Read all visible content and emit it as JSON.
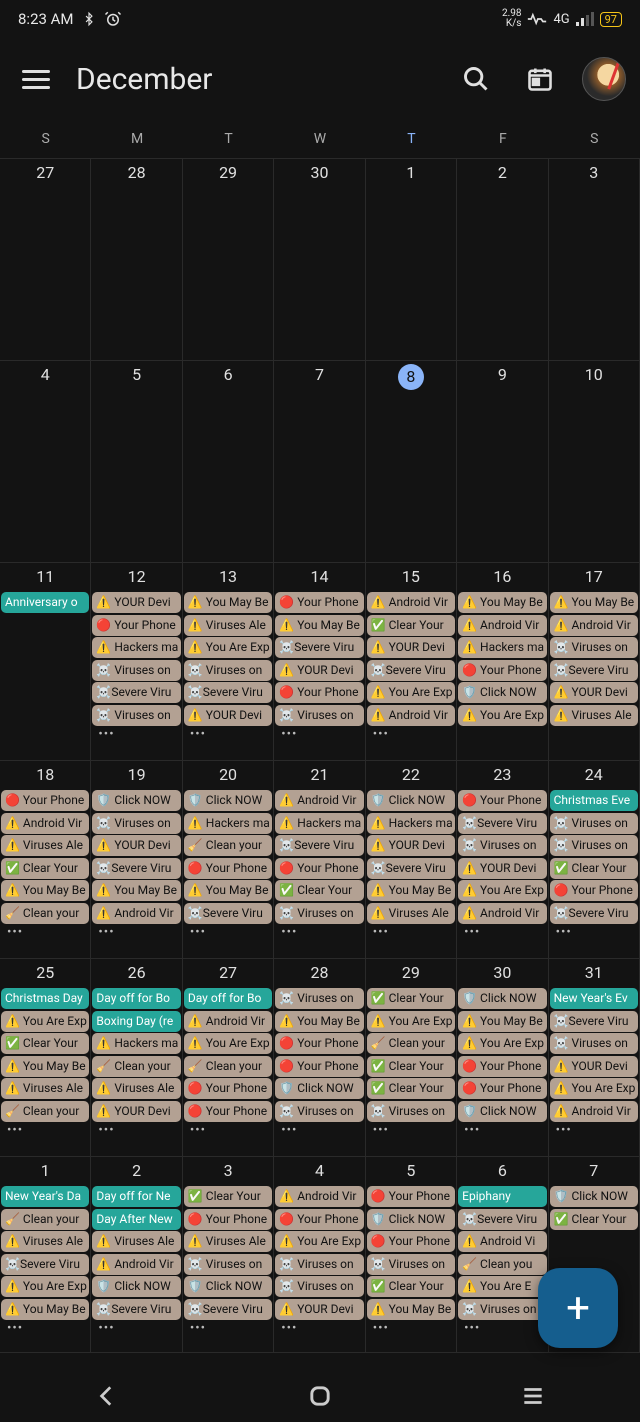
{
  "status": {
    "time": "8:23 AM",
    "net_speed": "2.98",
    "net_unit": "K/s",
    "net_type": "4G",
    "battery": "97"
  },
  "header": {
    "title": "December"
  },
  "weekdays": [
    "S",
    "M",
    "T",
    "W",
    "T",
    "F",
    "S"
  ],
  "today_col_index": 4,
  "rows": [
    [
      {
        "n": "27",
        "t": false,
        "e": []
      },
      {
        "n": "28",
        "t": false,
        "e": []
      },
      {
        "n": "29",
        "t": false,
        "e": []
      },
      {
        "n": "30",
        "t": false,
        "e": []
      },
      {
        "n": "1",
        "t": false,
        "e": []
      },
      {
        "n": "2",
        "t": false,
        "e": []
      },
      {
        "n": "3",
        "t": false,
        "e": []
      }
    ],
    [
      {
        "n": "4",
        "t": false,
        "e": []
      },
      {
        "n": "5",
        "t": false,
        "e": []
      },
      {
        "n": "6",
        "t": false,
        "e": []
      },
      {
        "n": "7",
        "t": false,
        "e": []
      },
      {
        "n": "8",
        "t": true,
        "e": []
      },
      {
        "n": "9",
        "t": false,
        "e": []
      },
      {
        "n": "10",
        "t": false,
        "e": []
      }
    ],
    [
      {
        "n": "11",
        "t": false,
        "more": false,
        "e": [
          {
            "c": "teal",
            "x": "Anniversary o"
          }
        ]
      },
      {
        "n": "12",
        "t": false,
        "more": true,
        "e": [
          {
            "c": "default",
            "x": "⚠️ YOUR Devi"
          },
          {
            "c": "default",
            "x": "🔴 Your Phone"
          },
          {
            "c": "default",
            "x": "⚠️ Hackers ma"
          },
          {
            "c": "default",
            "x": "☠️ Viruses on"
          },
          {
            "c": "default",
            "x": "☠️Severe Viru"
          },
          {
            "c": "default",
            "x": "☠️ Viruses on"
          }
        ]
      },
      {
        "n": "13",
        "t": false,
        "more": true,
        "e": [
          {
            "c": "default",
            "x": "⚠️ You May Be"
          },
          {
            "c": "default",
            "x": "⚠️ Viruses Ale"
          },
          {
            "c": "default",
            "x": "⚠️ You Are Exp"
          },
          {
            "c": "default",
            "x": "☠️ Viruses on"
          },
          {
            "c": "default",
            "x": "☠️Severe Viru"
          },
          {
            "c": "default",
            "x": "⚠️ YOUR Devi"
          }
        ]
      },
      {
        "n": "14",
        "t": false,
        "more": true,
        "e": [
          {
            "c": "default",
            "x": "🔴 Your Phone"
          },
          {
            "c": "default",
            "x": "⚠️ You May Be"
          },
          {
            "c": "default",
            "x": "☠️Severe Viru"
          },
          {
            "c": "default",
            "x": "⚠️ YOUR Devi"
          },
          {
            "c": "default",
            "x": "🔴 Your Phone"
          },
          {
            "c": "default",
            "x": "☠️ Viruses on"
          }
        ]
      },
      {
        "n": "15",
        "t": false,
        "more": true,
        "e": [
          {
            "c": "default",
            "x": "⚠️ Android Vir"
          },
          {
            "c": "default",
            "x": "✅ Clear Your"
          },
          {
            "c": "default",
            "x": "⚠️ YOUR Devi"
          },
          {
            "c": "default",
            "x": "☠️Severe Viru"
          },
          {
            "c": "default",
            "x": "⚠️ You Are Exp"
          },
          {
            "c": "default",
            "x": "⚠️ Android Vir"
          }
        ]
      },
      {
        "n": "16",
        "t": false,
        "more": false,
        "e": [
          {
            "c": "default",
            "x": "⚠️ You May Be"
          },
          {
            "c": "default",
            "x": "⚠️ Android Vir"
          },
          {
            "c": "default",
            "x": "⚠️ Hackers ma"
          },
          {
            "c": "default",
            "x": "🔴 Your Phone"
          },
          {
            "c": "default",
            "x": "🛡️ Click NOW"
          },
          {
            "c": "default",
            "x": "⚠️ You Are Exp"
          }
        ]
      },
      {
        "n": "17",
        "t": false,
        "more": false,
        "e": [
          {
            "c": "default",
            "x": "⚠️ You May Be"
          },
          {
            "c": "default",
            "x": "⚠️ Android Vir"
          },
          {
            "c": "default",
            "x": "☠️ Viruses on"
          },
          {
            "c": "default",
            "x": "☠️Severe Viru"
          },
          {
            "c": "default",
            "x": "⚠️ YOUR Devi"
          },
          {
            "c": "default",
            "x": "⚠️ Viruses Ale"
          }
        ]
      }
    ],
    [
      {
        "n": "18",
        "t": false,
        "more": true,
        "e": [
          {
            "c": "default",
            "x": "🔴 Your Phone"
          },
          {
            "c": "default",
            "x": "⚠️ Android Vir"
          },
          {
            "c": "default",
            "x": "⚠️ Viruses Ale"
          },
          {
            "c": "default",
            "x": "✅ Clear Your"
          },
          {
            "c": "default",
            "x": "⚠️ You May Be"
          },
          {
            "c": "default",
            "x": "🧹 Clean your"
          }
        ]
      },
      {
        "n": "19",
        "t": false,
        "more": true,
        "e": [
          {
            "c": "default",
            "x": "🛡️ Click NOW"
          },
          {
            "c": "default",
            "x": "☠️ Viruses on"
          },
          {
            "c": "default",
            "x": "⚠️ YOUR Devi"
          },
          {
            "c": "default",
            "x": "☠️Severe Viru"
          },
          {
            "c": "default",
            "x": "⚠️ You May Be"
          },
          {
            "c": "default",
            "x": "⚠️ Android Vir"
          }
        ]
      },
      {
        "n": "20",
        "t": false,
        "more": true,
        "e": [
          {
            "c": "default",
            "x": "🛡️ Click NOW"
          },
          {
            "c": "default",
            "x": "⚠️ Hackers ma"
          },
          {
            "c": "default",
            "x": "🧹 Clean your"
          },
          {
            "c": "default",
            "x": "🔴 Your Phone"
          },
          {
            "c": "default",
            "x": "⚠️ You May Be"
          },
          {
            "c": "default",
            "x": "☠️Severe Viru"
          }
        ]
      },
      {
        "n": "21",
        "t": false,
        "more": true,
        "e": [
          {
            "c": "default",
            "x": "⚠️ Android Vir"
          },
          {
            "c": "default",
            "x": "⚠️ Hackers ma"
          },
          {
            "c": "default",
            "x": "☠️Severe Viru"
          },
          {
            "c": "default",
            "x": "🔴 Your Phone"
          },
          {
            "c": "default",
            "x": "✅ Clear Your"
          },
          {
            "c": "default",
            "x": "☠️ Viruses on"
          }
        ]
      },
      {
        "n": "22",
        "t": false,
        "more": true,
        "e": [
          {
            "c": "default",
            "x": "🛡️ Click NOW"
          },
          {
            "c": "default",
            "x": "⚠️ Hackers ma"
          },
          {
            "c": "default",
            "x": "⚠️ YOUR Devi"
          },
          {
            "c": "default",
            "x": "☠️Severe Viru"
          },
          {
            "c": "default",
            "x": "⚠️ You May Be"
          },
          {
            "c": "default",
            "x": "⚠️ Viruses Ale"
          }
        ]
      },
      {
        "n": "23",
        "t": false,
        "more": true,
        "e": [
          {
            "c": "default",
            "x": "🔴 Your Phone"
          },
          {
            "c": "default",
            "x": "☠️Severe Viru"
          },
          {
            "c": "default",
            "x": "☠️ Viruses on"
          },
          {
            "c": "default",
            "x": "⚠️ YOUR Devi"
          },
          {
            "c": "default",
            "x": "⚠️ You Are Exp"
          },
          {
            "c": "default",
            "x": "⚠️ Android Vir"
          }
        ]
      },
      {
        "n": "24",
        "t": false,
        "more": true,
        "e": [
          {
            "c": "teal",
            "x": "Christmas Eve"
          },
          {
            "c": "default",
            "x": "☠️ Viruses on"
          },
          {
            "c": "default",
            "x": "☠️ Viruses on"
          },
          {
            "c": "default",
            "x": "✅ Clear Your"
          },
          {
            "c": "default",
            "x": "🔴 Your Phone"
          },
          {
            "c": "default",
            "x": "☠️Severe Viru"
          }
        ]
      }
    ],
    [
      {
        "n": "25",
        "t": false,
        "more": true,
        "e": [
          {
            "c": "teal",
            "x": "Christmas Day"
          },
          {
            "c": "default",
            "x": "⚠️ You Are Exp"
          },
          {
            "c": "default",
            "x": "✅ Clear Your"
          },
          {
            "c": "default",
            "x": "⚠️ You May Be"
          },
          {
            "c": "default",
            "x": "⚠️ Viruses Ale"
          },
          {
            "c": "default",
            "x": "🧹 Clean your"
          }
        ]
      },
      {
        "n": "26",
        "t": false,
        "more": true,
        "e": [
          {
            "c": "teal",
            "x": "Day off for Bo"
          },
          {
            "c": "teal",
            "x": "Boxing Day (re"
          },
          {
            "c": "default",
            "x": "⚠️ Hackers ma"
          },
          {
            "c": "default",
            "x": "🧹 Clean your"
          },
          {
            "c": "default",
            "x": "⚠️ Viruses Ale"
          },
          {
            "c": "default",
            "x": "⚠️ YOUR Devi"
          }
        ]
      },
      {
        "n": "27",
        "t": false,
        "more": true,
        "e": [
          {
            "c": "teal",
            "x": "Day off for Bo"
          },
          {
            "c": "default",
            "x": "⚠️ Android Vir"
          },
          {
            "c": "default",
            "x": "⚠️ You Are Exp"
          },
          {
            "c": "default",
            "x": "🧹 Clean your"
          },
          {
            "c": "default",
            "x": "🔴 Your Phone"
          },
          {
            "c": "default",
            "x": "🔴 Your Phone"
          }
        ]
      },
      {
        "n": "28",
        "t": false,
        "more": true,
        "e": [
          {
            "c": "default",
            "x": "☠️ Viruses on"
          },
          {
            "c": "default",
            "x": "⚠️ You May Be"
          },
          {
            "c": "default",
            "x": "🔴 Your Phone"
          },
          {
            "c": "default",
            "x": "🔴 Your Phone"
          },
          {
            "c": "default",
            "x": "🛡️ Click NOW"
          },
          {
            "c": "default",
            "x": "☠️ Viruses on"
          }
        ]
      },
      {
        "n": "29",
        "t": false,
        "more": true,
        "e": [
          {
            "c": "default",
            "x": "✅ Clear Your"
          },
          {
            "c": "default",
            "x": "⚠️ You Are Exp"
          },
          {
            "c": "default",
            "x": "🧹 Clean your"
          },
          {
            "c": "default",
            "x": "✅ Clear Your"
          },
          {
            "c": "default",
            "x": "✅ Clear Your"
          },
          {
            "c": "default",
            "x": "☠️ Viruses on"
          }
        ]
      },
      {
        "n": "30",
        "t": false,
        "more": true,
        "e": [
          {
            "c": "default",
            "x": "🛡️ Click NOW"
          },
          {
            "c": "default",
            "x": "⚠️ You May Be"
          },
          {
            "c": "default",
            "x": "⚠️ You Are Exp"
          },
          {
            "c": "default",
            "x": "🔴 Your Phone"
          },
          {
            "c": "default",
            "x": "🔴 Your Phone"
          },
          {
            "c": "default",
            "x": "🛡️ Click NOW"
          }
        ]
      },
      {
        "n": "31",
        "t": false,
        "more": true,
        "e": [
          {
            "c": "teal",
            "x": "New Year's Ev"
          },
          {
            "c": "default",
            "x": "☠️Severe Viru"
          },
          {
            "c": "default",
            "x": "☠️ Viruses on"
          },
          {
            "c": "default",
            "x": "⚠️ YOUR Devi"
          },
          {
            "c": "default",
            "x": "⚠️ You Are Exp"
          },
          {
            "c": "default",
            "x": "⚠️ Android Vir"
          }
        ]
      }
    ],
    [
      {
        "n": "1",
        "t": false,
        "more": true,
        "e": [
          {
            "c": "teal",
            "x": "New Year's Da"
          },
          {
            "c": "default",
            "x": "🧹 Clean your"
          },
          {
            "c": "default",
            "x": "⚠️ Viruses Ale"
          },
          {
            "c": "default",
            "x": "☠️Severe Viru"
          },
          {
            "c": "default",
            "x": "⚠️ You Are Exp"
          },
          {
            "c": "default",
            "x": "⚠️ You May Be"
          }
        ]
      },
      {
        "n": "2",
        "t": false,
        "more": true,
        "e": [
          {
            "c": "teal",
            "x": "Day off for Ne"
          },
          {
            "c": "teal",
            "x": "Day After New"
          },
          {
            "c": "default",
            "x": "⚠️ Viruses Ale"
          },
          {
            "c": "default",
            "x": "⚠️ Android Vir"
          },
          {
            "c": "default",
            "x": "🛡️ Click NOW"
          },
          {
            "c": "default",
            "x": "☠️Severe Viru"
          }
        ]
      },
      {
        "n": "3",
        "t": false,
        "more": true,
        "e": [
          {
            "c": "default",
            "x": "✅ Clear Your"
          },
          {
            "c": "default",
            "x": "🔴 Your Phone"
          },
          {
            "c": "default",
            "x": "⚠️ Viruses Ale"
          },
          {
            "c": "default",
            "x": "☠️ Viruses on"
          },
          {
            "c": "default",
            "x": "🛡️ Click NOW"
          },
          {
            "c": "default",
            "x": "☠️Severe Viru"
          }
        ]
      },
      {
        "n": "4",
        "t": false,
        "more": true,
        "e": [
          {
            "c": "default",
            "x": "⚠️ Android Vir"
          },
          {
            "c": "default",
            "x": "🔴 Your Phone"
          },
          {
            "c": "default",
            "x": "⚠️ You Are Exp"
          },
          {
            "c": "default",
            "x": "☠️ Viruses on"
          },
          {
            "c": "default",
            "x": "☠️ Viruses on"
          },
          {
            "c": "default",
            "x": "⚠️ YOUR Devi"
          }
        ]
      },
      {
        "n": "5",
        "t": false,
        "more": true,
        "e": [
          {
            "c": "default",
            "x": "🔴 Your Phone"
          },
          {
            "c": "default",
            "x": "🛡️ Click NOW"
          },
          {
            "c": "default",
            "x": "🔴 Your Phone"
          },
          {
            "c": "default",
            "x": "☠️ Viruses on"
          },
          {
            "c": "default",
            "x": "✅ Clear Your"
          },
          {
            "c": "default",
            "x": "⚠️ You May Be"
          }
        ]
      },
      {
        "n": "6",
        "t": false,
        "more": true,
        "e": [
          {
            "c": "teal",
            "x": "Epiphany"
          },
          {
            "c": "default",
            "x": "☠️Severe Viru"
          },
          {
            "c": "default",
            "x": "⚠️ Android Vi"
          },
          {
            "c": "default",
            "x": "🧹 Clean you"
          },
          {
            "c": "default",
            "x": "⚠️ You Are E"
          },
          {
            "c": "default",
            "x": "☠️ Viruses on"
          }
        ]
      },
      {
        "n": "7",
        "t": false,
        "more": false,
        "e": [
          {
            "c": "default",
            "x": "🛡️ Click NOW"
          },
          {
            "c": "default",
            "x": "✅ Clear Your"
          }
        ]
      }
    ]
  ],
  "fab": "+",
  "more_dots": "•••"
}
